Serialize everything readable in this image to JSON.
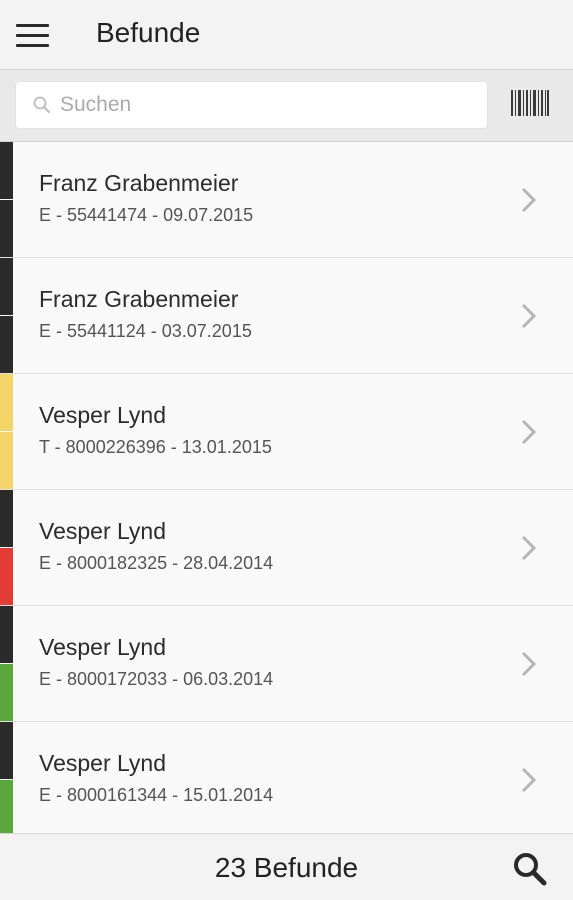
{
  "header": {
    "title": "Befunde",
    "menu_icon": "menu-icon"
  },
  "search": {
    "placeholder": "Suchen",
    "value": "",
    "search_icon": "search-icon",
    "barcode_icon": "barcode-icon"
  },
  "colors": {
    "dark": "#2b2b2b",
    "yellow": "#f5d569",
    "red": "#e33b36",
    "green": "#5aa83c"
  },
  "items": [
    {
      "name": "Franz Grabenmeier",
      "meta": "E - 55441474 - 09.07.2015",
      "stripe_top": "#2b2b2b",
      "stripe_bottom": "#2b2b2b"
    },
    {
      "name": "Franz Grabenmeier",
      "meta": "E - 55441124 - 03.07.2015",
      "stripe_top": "#2b2b2b",
      "stripe_bottom": "#2b2b2b"
    },
    {
      "name": "Vesper Lynd",
      "meta": "T - 8000226396 - 13.01.2015",
      "stripe_top": "#f5d569",
      "stripe_bottom": "#f5d569"
    },
    {
      "name": "Vesper Lynd",
      "meta": "E - 8000182325 - 28.04.2014",
      "stripe_top": "#2b2b2b",
      "stripe_bottom": "#e33b36"
    },
    {
      "name": "Vesper Lynd",
      "meta": "E - 8000172033 - 06.03.2014",
      "stripe_top": "#2b2b2b",
      "stripe_bottom": "#5aa83c"
    },
    {
      "name": "Vesper Lynd",
      "meta": "E - 8000161344 - 15.01.2014",
      "stripe_top": "#2b2b2b",
      "stripe_bottom": "#5aa83c"
    }
  ],
  "footer": {
    "count": "23 Befunde",
    "search_icon": "search-icon"
  }
}
